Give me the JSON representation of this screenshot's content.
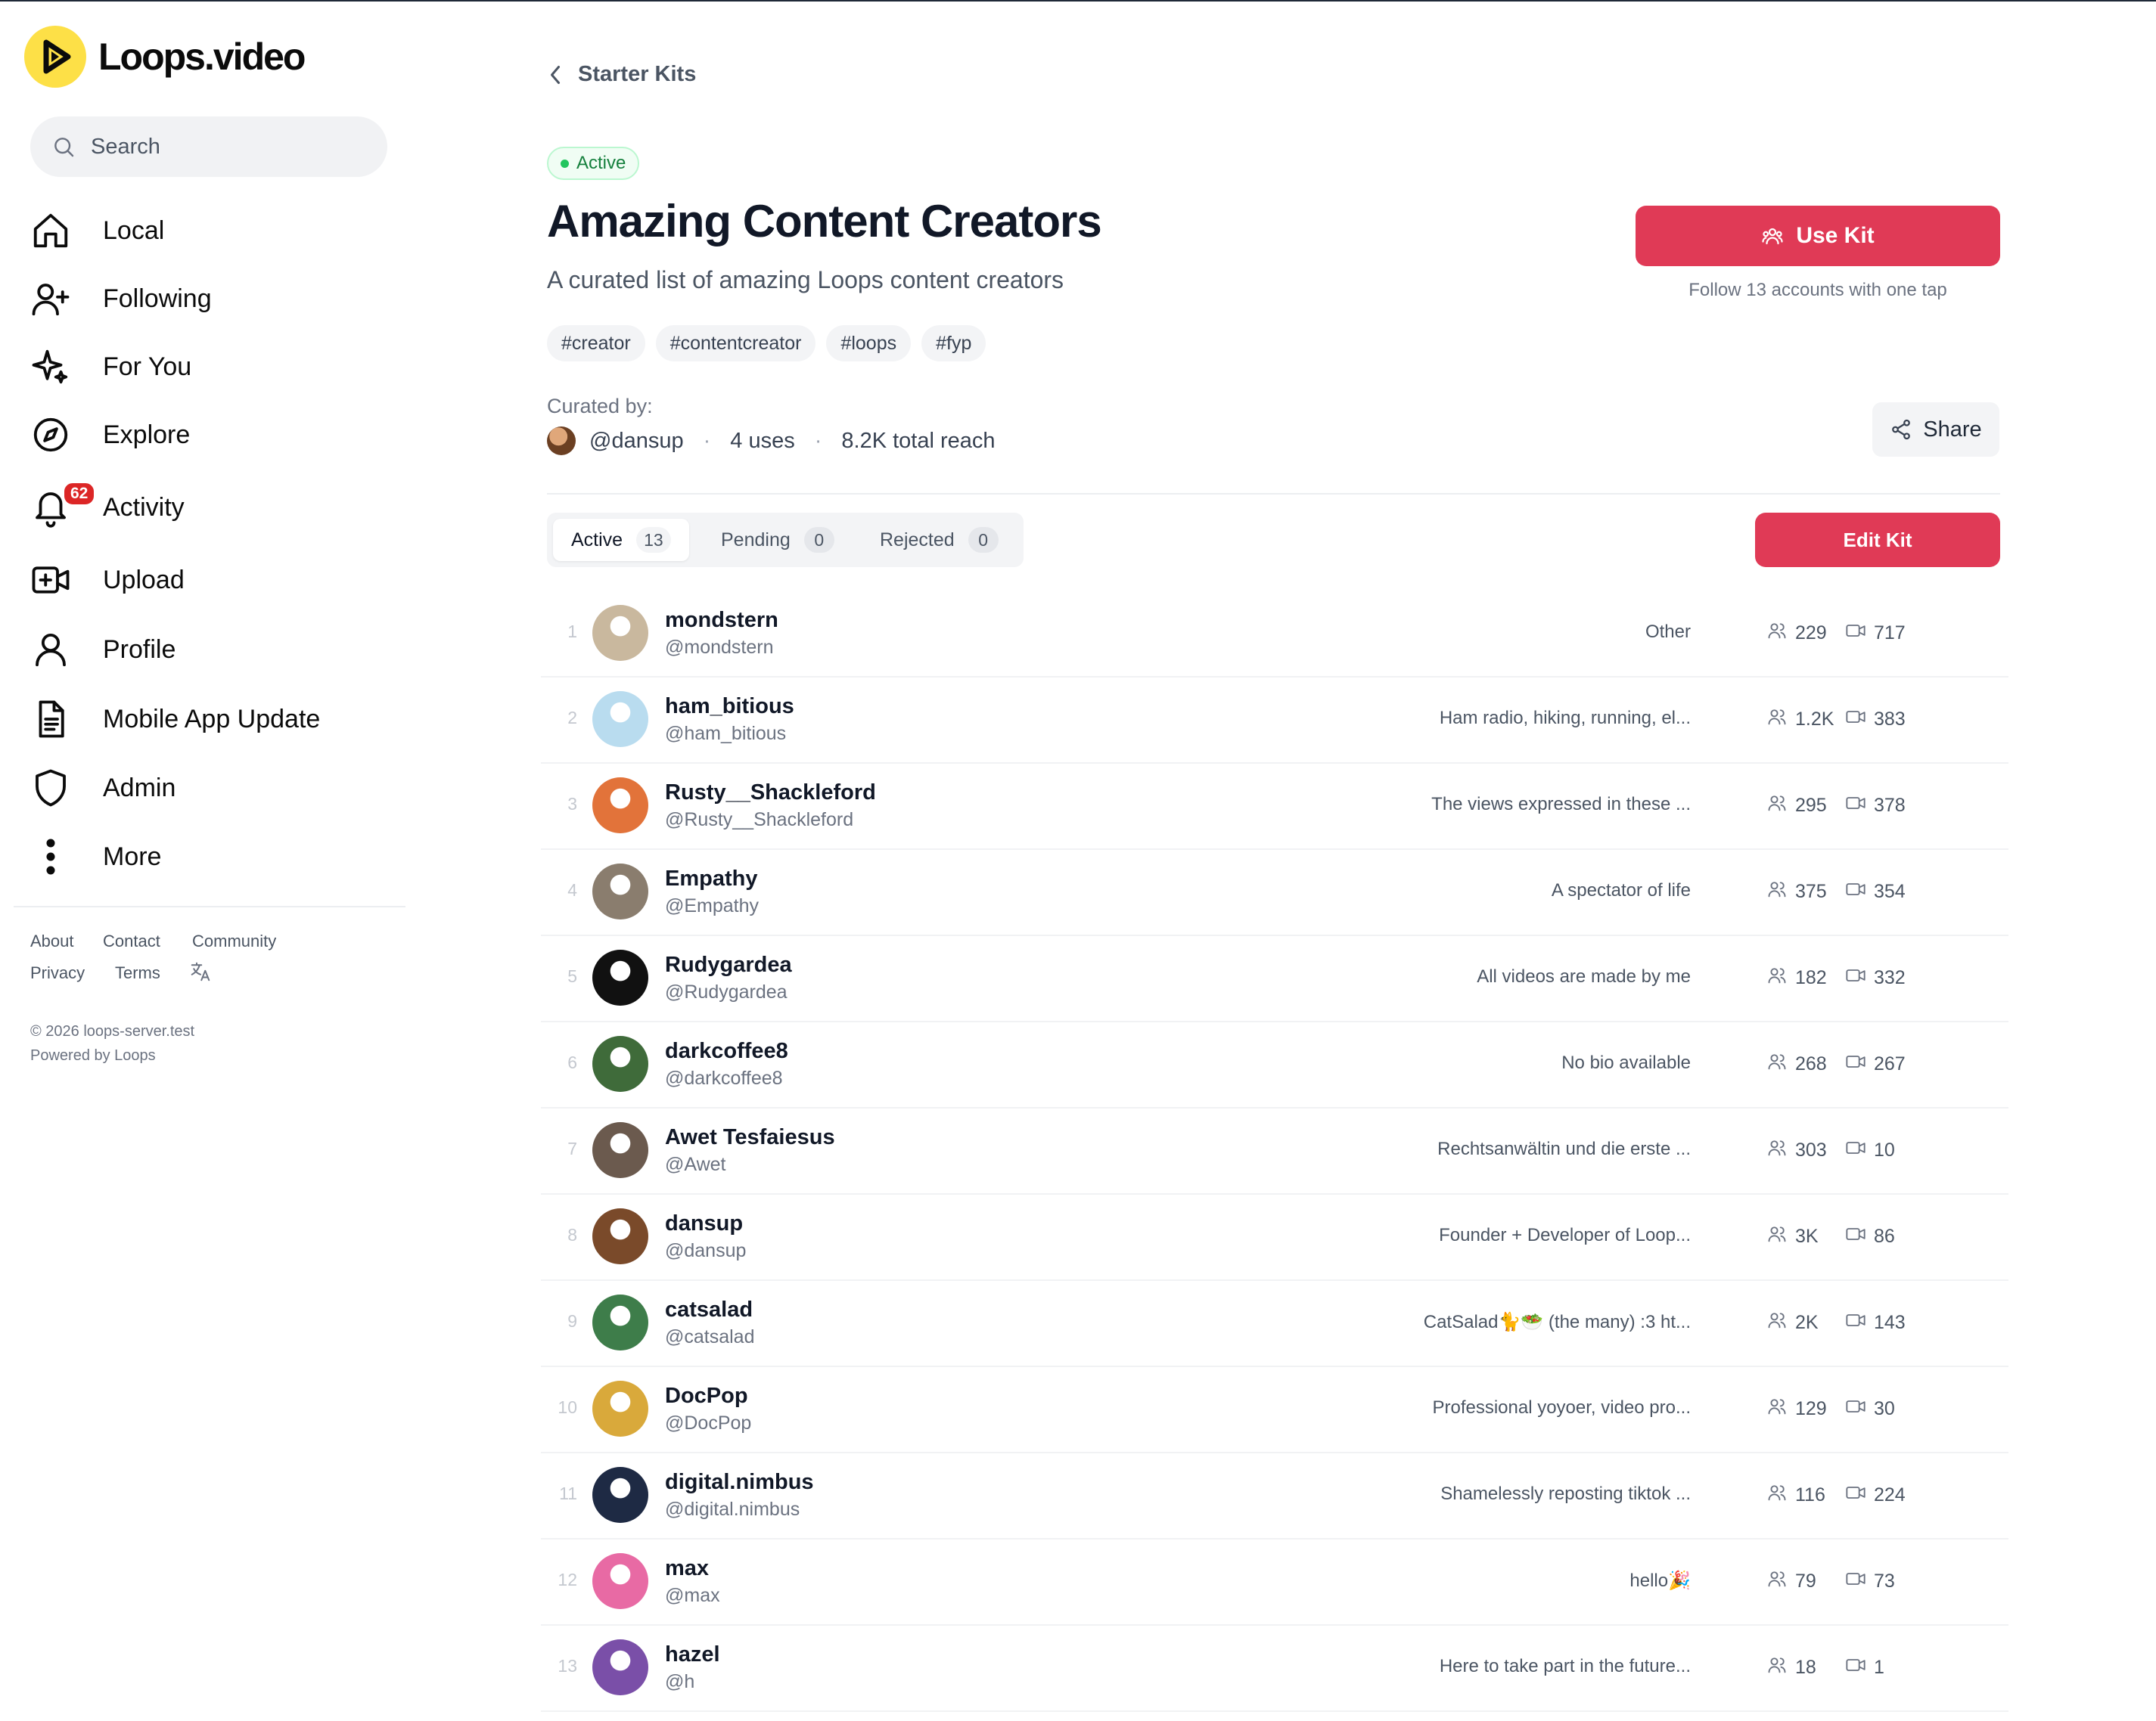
{
  "brand": {
    "name": "Loops.video",
    "accent": "#fde047"
  },
  "search": {
    "placeholder": "Search"
  },
  "nav": [
    {
      "label": "Local",
      "icon": "home-icon"
    },
    {
      "label": "Following",
      "icon": "user-plus-icon"
    },
    {
      "label": "For You",
      "icon": "sparkles-icon"
    },
    {
      "label": "Explore",
      "icon": "compass-icon"
    },
    {
      "label": "Activity",
      "icon": "bell-icon",
      "badge": "62"
    },
    {
      "label": "Upload",
      "icon": "video-plus-icon"
    },
    {
      "label": "Profile",
      "icon": "user-icon"
    },
    {
      "label": "Mobile App Update",
      "icon": "document-icon"
    },
    {
      "label": "Admin",
      "icon": "shield-icon"
    },
    {
      "label": "More",
      "icon": "more-vertical-icon"
    }
  ],
  "footer": {
    "links": [
      "About",
      "Contact",
      "Community",
      "Privacy",
      "Terms"
    ],
    "copyright": "© 2026 loops-server.test",
    "powered": "Powered by Loops"
  },
  "page": {
    "back_label": "Starter Kits",
    "status": "Active",
    "title": "Amazing Content Creators",
    "subtitle": "A curated list of amazing Loops content creators",
    "tags": [
      "#creator",
      "#contentcreator",
      "#loops",
      "#fyp"
    ],
    "curated_by_label": "Curated by:",
    "curator": "@dansup",
    "uses": "4 uses",
    "reach": "8.2K total reach",
    "use_kit_label": "Use Kit",
    "use_kit_hint": "Follow 13 accounts with one tap",
    "share_label": "Share",
    "edit_kit_label": "Edit Kit",
    "brand_color": "#e03a56"
  },
  "tabs": [
    {
      "label": "Active",
      "count": "13"
    },
    {
      "label": "Pending",
      "count": "0"
    },
    {
      "label": "Rejected",
      "count": "0"
    }
  ],
  "accounts": [
    {
      "index": "1",
      "name": "mondstern",
      "handle": "@mondstern",
      "bio": "Other",
      "followers": "229",
      "videos": "717",
      "avatar_color": "#c9b89e"
    },
    {
      "index": "2",
      "name": "ham_bitious",
      "handle": "@ham_bitious",
      "bio": "Ham radio, hiking, running, el...",
      "followers": "1.2K",
      "videos": "383",
      "avatar_color": "#b9dcef"
    },
    {
      "index": "3",
      "name": "Rusty__Shackleford",
      "handle": "@Rusty__Shackleford",
      "bio": "The views expressed in these ...",
      "followers": "295",
      "videos": "378",
      "avatar_color": "#e2733a"
    },
    {
      "index": "4",
      "name": "Empathy",
      "handle": "@Empathy",
      "bio": "A spectator of life",
      "followers": "375",
      "videos": "354",
      "avatar_color": "#8a7d6e"
    },
    {
      "index": "5",
      "name": "Rudygardea",
      "handle": "@Rudygardea",
      "bio": "All videos are made by me",
      "followers": "182",
      "videos": "332",
      "avatar_color": "#111111"
    },
    {
      "index": "6",
      "name": "darkcoffee8",
      "handle": "@darkcoffee8",
      "bio": "No bio available",
      "followers": "268",
      "videos": "267",
      "avatar_color": "#3f6b3a"
    },
    {
      "index": "7",
      "name": "Awet Tesfaiesus",
      "handle": "@Awet",
      "bio": "Rechtsanwältin und die erste ...",
      "followers": "303",
      "videos": "10",
      "avatar_color": "#6b5a4e"
    },
    {
      "index": "8",
      "name": "dansup",
      "handle": "@dansup",
      "bio": "Founder + Developer of Loop...",
      "followers": "3K",
      "videos": "86",
      "avatar_color": "#7a4a2a"
    },
    {
      "index": "9",
      "name": "catsalad",
      "handle": "@catsalad",
      "bio": "CatSalad🐈🥗 (the many) :3 ht...",
      "followers": "2K",
      "videos": "143",
      "avatar_color": "#3e7d4a"
    },
    {
      "index": "10",
      "name": "DocPop",
      "handle": "@DocPop",
      "bio": "Professional yoyoer, video pro...",
      "followers": "129",
      "videos": "30",
      "avatar_color": "#d9a93b"
    },
    {
      "index": "11",
      "name": "digital.nimbus",
      "handle": "@digital.nimbus",
      "bio": "Shamelessly reposting tiktok ...",
      "followers": "116",
      "videos": "224",
      "avatar_color": "#1e2a44"
    },
    {
      "index": "12",
      "name": "max",
      "handle": "@max",
      "bio": "hello🎉",
      "followers": "79",
      "videos": "73",
      "avatar_color": "#e86aa4"
    },
    {
      "index": "13",
      "name": "hazel",
      "handle": "@h",
      "bio": "Here to take part in the future...",
      "followers": "18",
      "videos": "1",
      "avatar_color": "#7a4fa8"
    }
  ]
}
